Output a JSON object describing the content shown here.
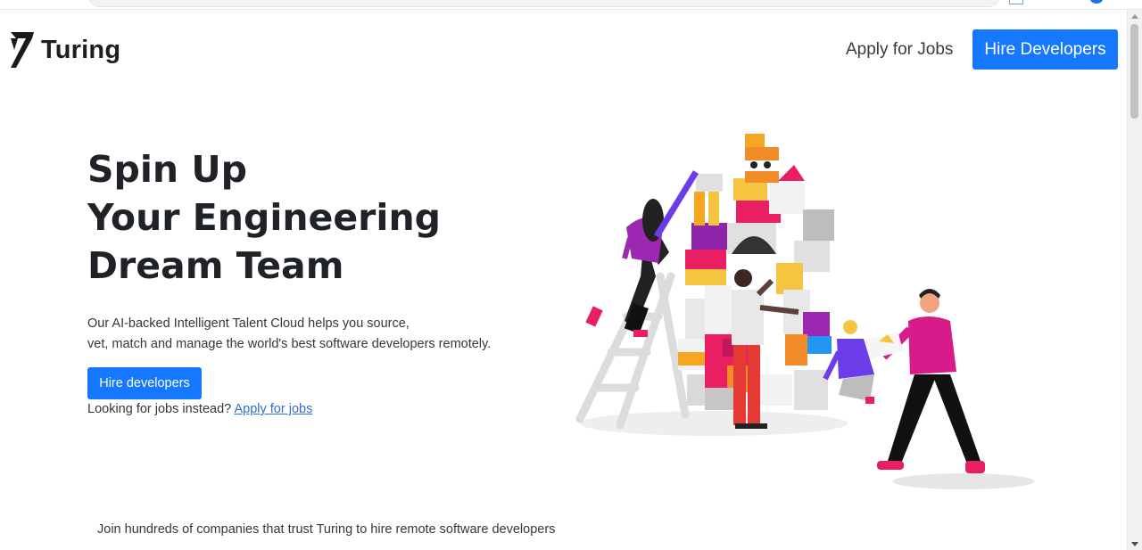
{
  "header": {
    "brand": "Turing",
    "nav_apply": "Apply for Jobs",
    "nav_hire": "Hire Developers"
  },
  "hero": {
    "title_lines": [
      "Spin Up",
      "Your Engineering",
      "Dream Team"
    ],
    "desc_lines": [
      "Our AI-backed Intelligent Talent Cloud helps you source,",
      "vet, match and manage the world's best software developers remotely."
    ],
    "cta_label": "Hire developers",
    "alt_prompt": "Looking for jobs instead?",
    "alt_link": "Apply for jobs"
  },
  "trust": {
    "text": "Join hundreds of companies that trust Turing to hire remote software developers"
  },
  "colors": {
    "accent": "#1677ff",
    "link": "#2f6fd6",
    "text": "#1f2328"
  },
  "icons": {
    "logo": "turing-logo-icon",
    "illustration": "team-building-blocks-illustration"
  }
}
